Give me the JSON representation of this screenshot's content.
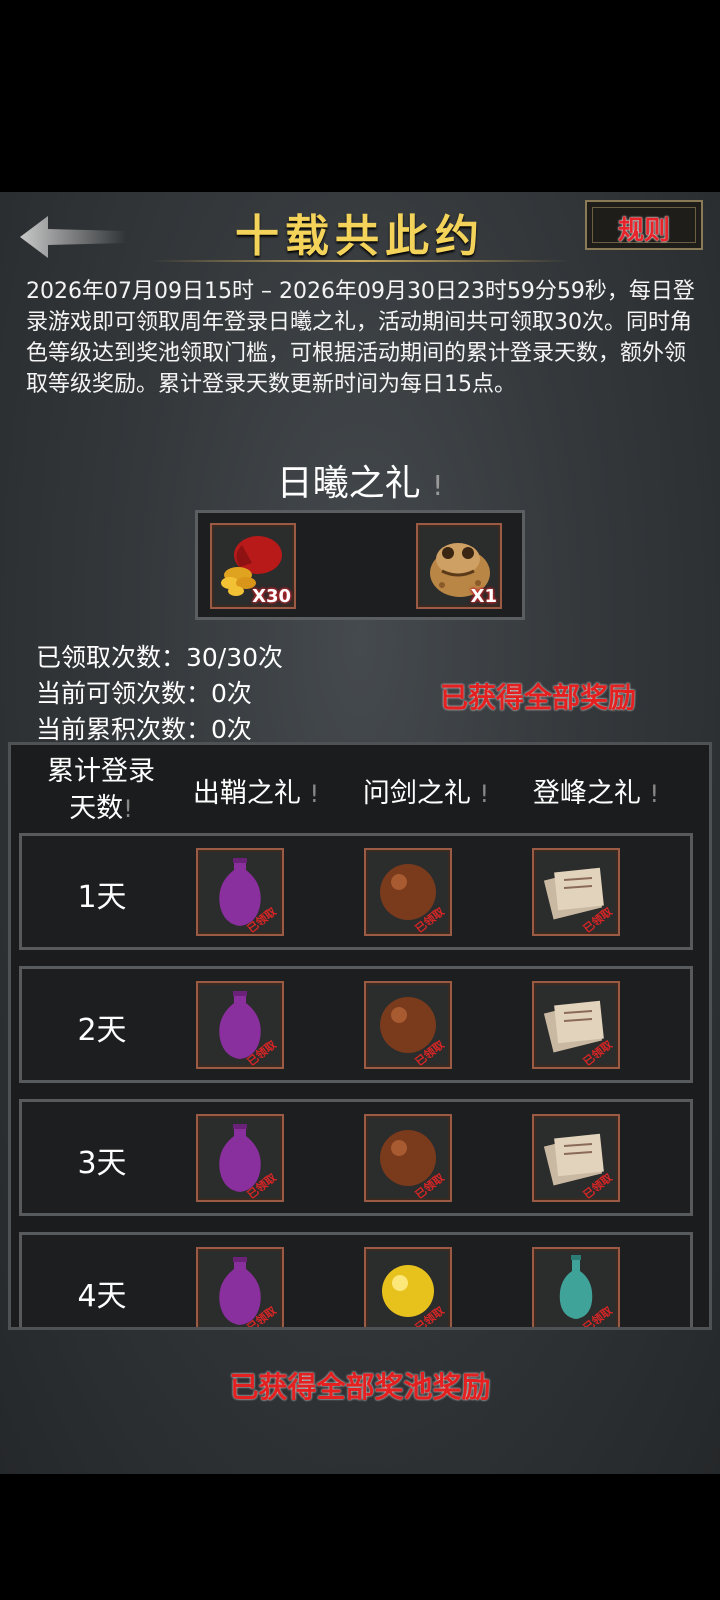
{
  "header": {
    "title": "十载共此约",
    "rules_label": "规则"
  },
  "description": "2026年07月09日15时 – 2026年09月30日23时59分59秒，每日登录游戏即可领取周年登录日曦之礼，活动期间共可领取30次。同时角色等级达到奖池领取门槛，可根据活动期间的累计登录天数，额外领取等级奖励。累计登录天数更新时间为每日15点。",
  "daily_gift": {
    "title": "日曦之礼",
    "info_mark": "!",
    "items": [
      {
        "icon": "money-pouch-icon",
        "qty": "X30"
      },
      {
        "icon": "golden-toad-icon",
        "qty": "X1"
      }
    ]
  },
  "stats": {
    "claimed": "已领取次数：30/30次",
    "available": "当前可领次数：0次",
    "accumulated": "当前累积次数：0次"
  },
  "status_all_claimed": "已获得全部奖励",
  "table": {
    "col_days": "累计登录天数",
    "col_days_line1": "累计登录",
    "col_days_line2": "天数",
    "col_tier1": "出鞘之礼",
    "col_tier2": "问剑之礼",
    "col_tier3": "登峰之礼",
    "info_mark": "!",
    "claimed_stamp": "已领取",
    "rows": [
      {
        "day": "1天",
        "items": [
          "purple-vase-icon",
          "brown-orb-icon",
          "scroll-papers-icon"
        ]
      },
      {
        "day": "2天",
        "items": [
          "purple-vase-icon",
          "brown-orb-icon",
          "scroll-papers-icon"
        ]
      },
      {
        "day": "3天",
        "items": [
          "purple-vase-icon",
          "brown-orb-icon",
          "scroll-papers-icon"
        ]
      },
      {
        "day": "4天",
        "items": [
          "purple-vase-icon",
          "golden-orb-icon",
          "jade-bottle-icon"
        ]
      }
    ]
  },
  "bottom_status": "已获得全部奖池奖励",
  "colors": {
    "title_gold": "#f3d35a",
    "alert_red": "#e52020",
    "frame_copper": "#9b5a44"
  }
}
